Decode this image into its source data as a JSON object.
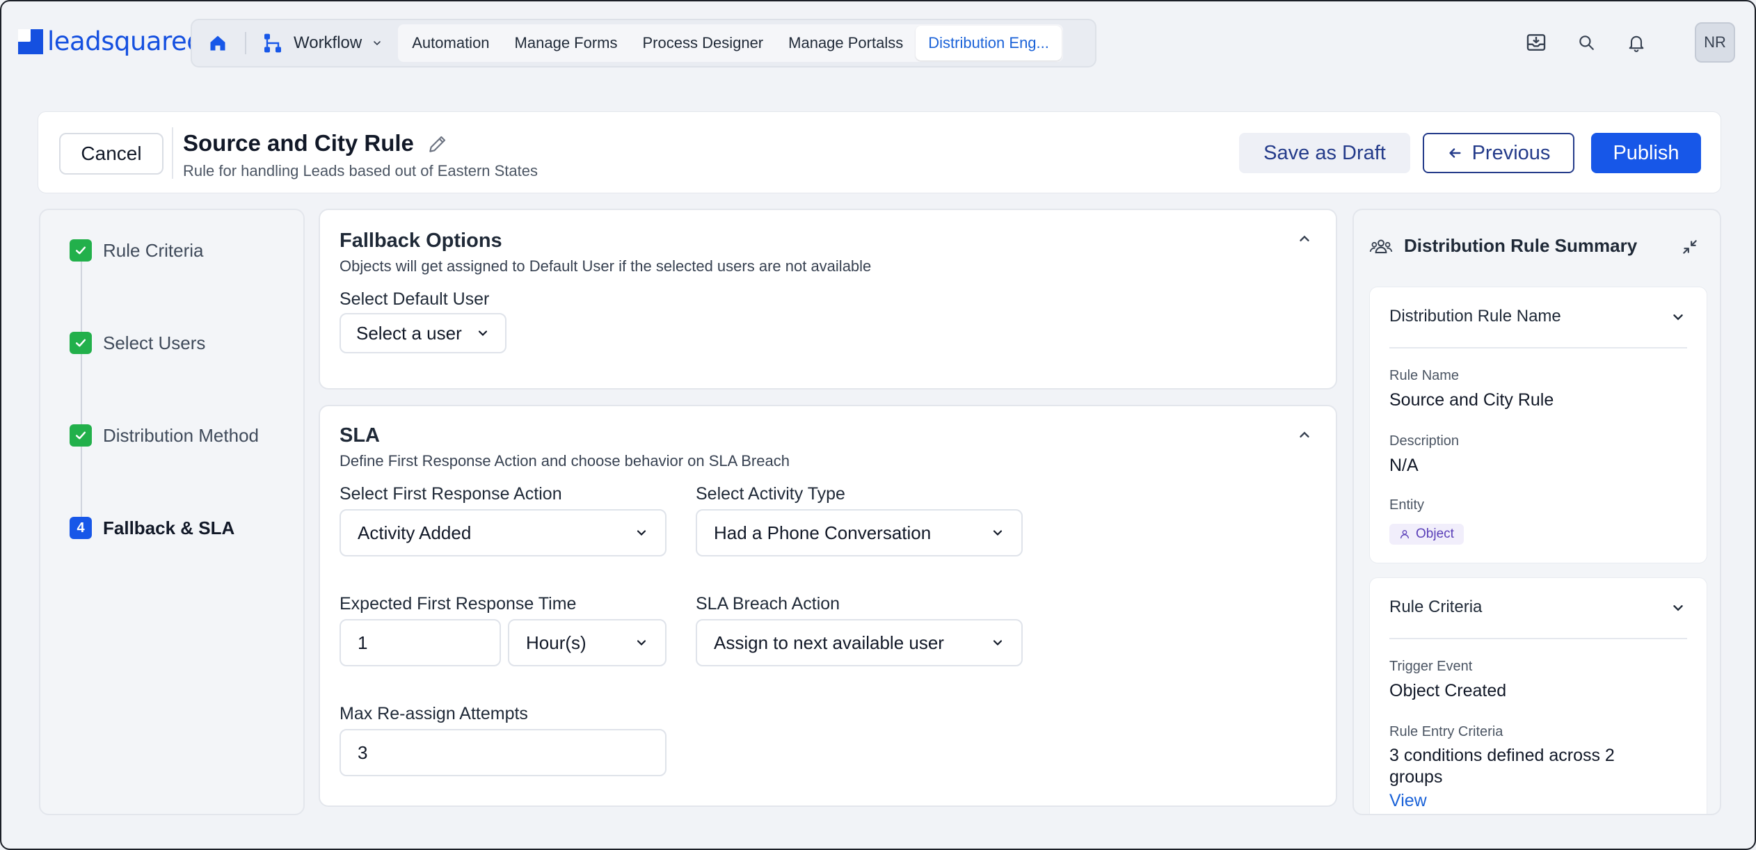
{
  "brand": {
    "name": "leadsquared"
  },
  "nav": {
    "workflow_label": "Workflow",
    "tabs": [
      "Automation",
      "Manage Forms",
      "Process Designer",
      "Manage Portalss",
      "Distribution Eng..."
    ],
    "active_tab": "Distribution Eng...",
    "user_initials": "NR"
  },
  "header": {
    "cancel_label": "Cancel",
    "title": "Source and City Rule",
    "subtitle": "Rule for handling Leads based out of Eastern States",
    "save_draft_label": "Save as Draft",
    "previous_label": "Previous",
    "publish_label": "Publish"
  },
  "steps": [
    {
      "label": "Rule Criteria",
      "status": "done"
    },
    {
      "label": "Select Users",
      "status": "done"
    },
    {
      "label": "Distribution Method",
      "status": "done"
    },
    {
      "label": "Fallback & SLA",
      "status": "current",
      "number": "4"
    }
  ],
  "fallback": {
    "title": "Fallback Options",
    "subtitle": "Objects will get assigned to Default User if the selected users are not available",
    "default_user_label": "Select Default User",
    "default_user_value": "Select a user"
  },
  "sla": {
    "title": "SLA",
    "subtitle": "Define First Response Action and choose behavior on SLA Breach",
    "first_response_label": "Select First Response Action",
    "first_response_value": "Activity Added",
    "activity_type_label": "Select Activity Type",
    "activity_type_value": "Had a Phone Conversation",
    "expected_time_label": "Expected First Response Time",
    "expected_time_value": "1",
    "expected_time_unit": "Hour(s)",
    "breach_action_label": "SLA Breach Action",
    "breach_action_value": "Assign to next available user",
    "max_attempts_label": "Max Re-assign Attempts",
    "max_attempts_value": "3"
  },
  "summary": {
    "title": "Distribution Rule Summary",
    "name_section": {
      "header": "Distribution Rule Name",
      "rule_name_key": "Rule Name",
      "rule_name_value": "Source and City Rule",
      "description_key": "Description",
      "description_value": "N/A",
      "entity_key": "Entity",
      "entity_value": "Object"
    },
    "criteria_section": {
      "header": "Rule Criteria",
      "trigger_key": "Trigger Event",
      "trigger_value": "Object Created",
      "entry_key": "Rule Entry Criteria",
      "entry_value": "3 conditions defined across 2 groups",
      "view_label": "View"
    }
  },
  "colors": {
    "primary": "#1757e8",
    "success": "#22b04b",
    "link": "#1a62d8",
    "navy": "#243b8a"
  }
}
